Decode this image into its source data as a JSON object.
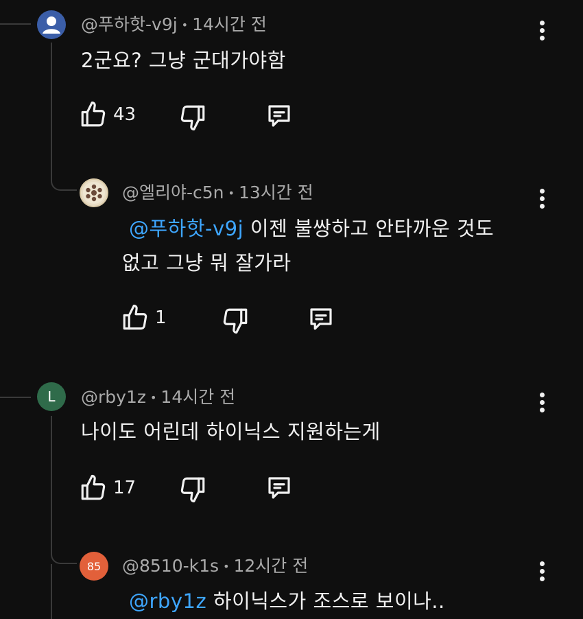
{
  "comments": [
    {
      "author": "@푸하핫-v9j",
      "time": "14시간 전",
      "text": "2군요? 그냥 군대가야함",
      "likes": "43",
      "avatar": {
        "type": "person-silhouette-icon",
        "bg": "#3b5ea8"
      }
    },
    {
      "author": "@엘리야-c5n",
      "time": "13시간 전",
      "mention": "@푸하핫-v9j",
      "text_line1": " 이젠 불쌍하고 안타까운 것도",
      "text_line2": "없고 그냥 뭐 잘가라",
      "likes": "1",
      "avatar": {
        "type": "seed-pattern-icon",
        "bg": "#e8dcc4"
      }
    },
    {
      "author": "@rby1z",
      "time": "14시간 전",
      "text": "나이도 어린데 하이닉스 지원하는게",
      "likes": "17",
      "avatar": {
        "type": "letter",
        "letter": "L",
        "bg": "#2f6b4a"
      }
    },
    {
      "author": "@8510-k1s",
      "time": "12시간 전",
      "mention": "@rby1z",
      "text": " 하이닉스가 조스로 보이나..",
      "avatar": {
        "type": "letter",
        "letter": "85",
        "bg": "#e2603a"
      }
    }
  ],
  "meta_separator": "•",
  "colors": {
    "background": "#0f0f0f",
    "text": "#f1f1f1",
    "meta": "#aaaaaa",
    "mention": "#3ea6ff",
    "thread_line": "#3a3a3a"
  }
}
